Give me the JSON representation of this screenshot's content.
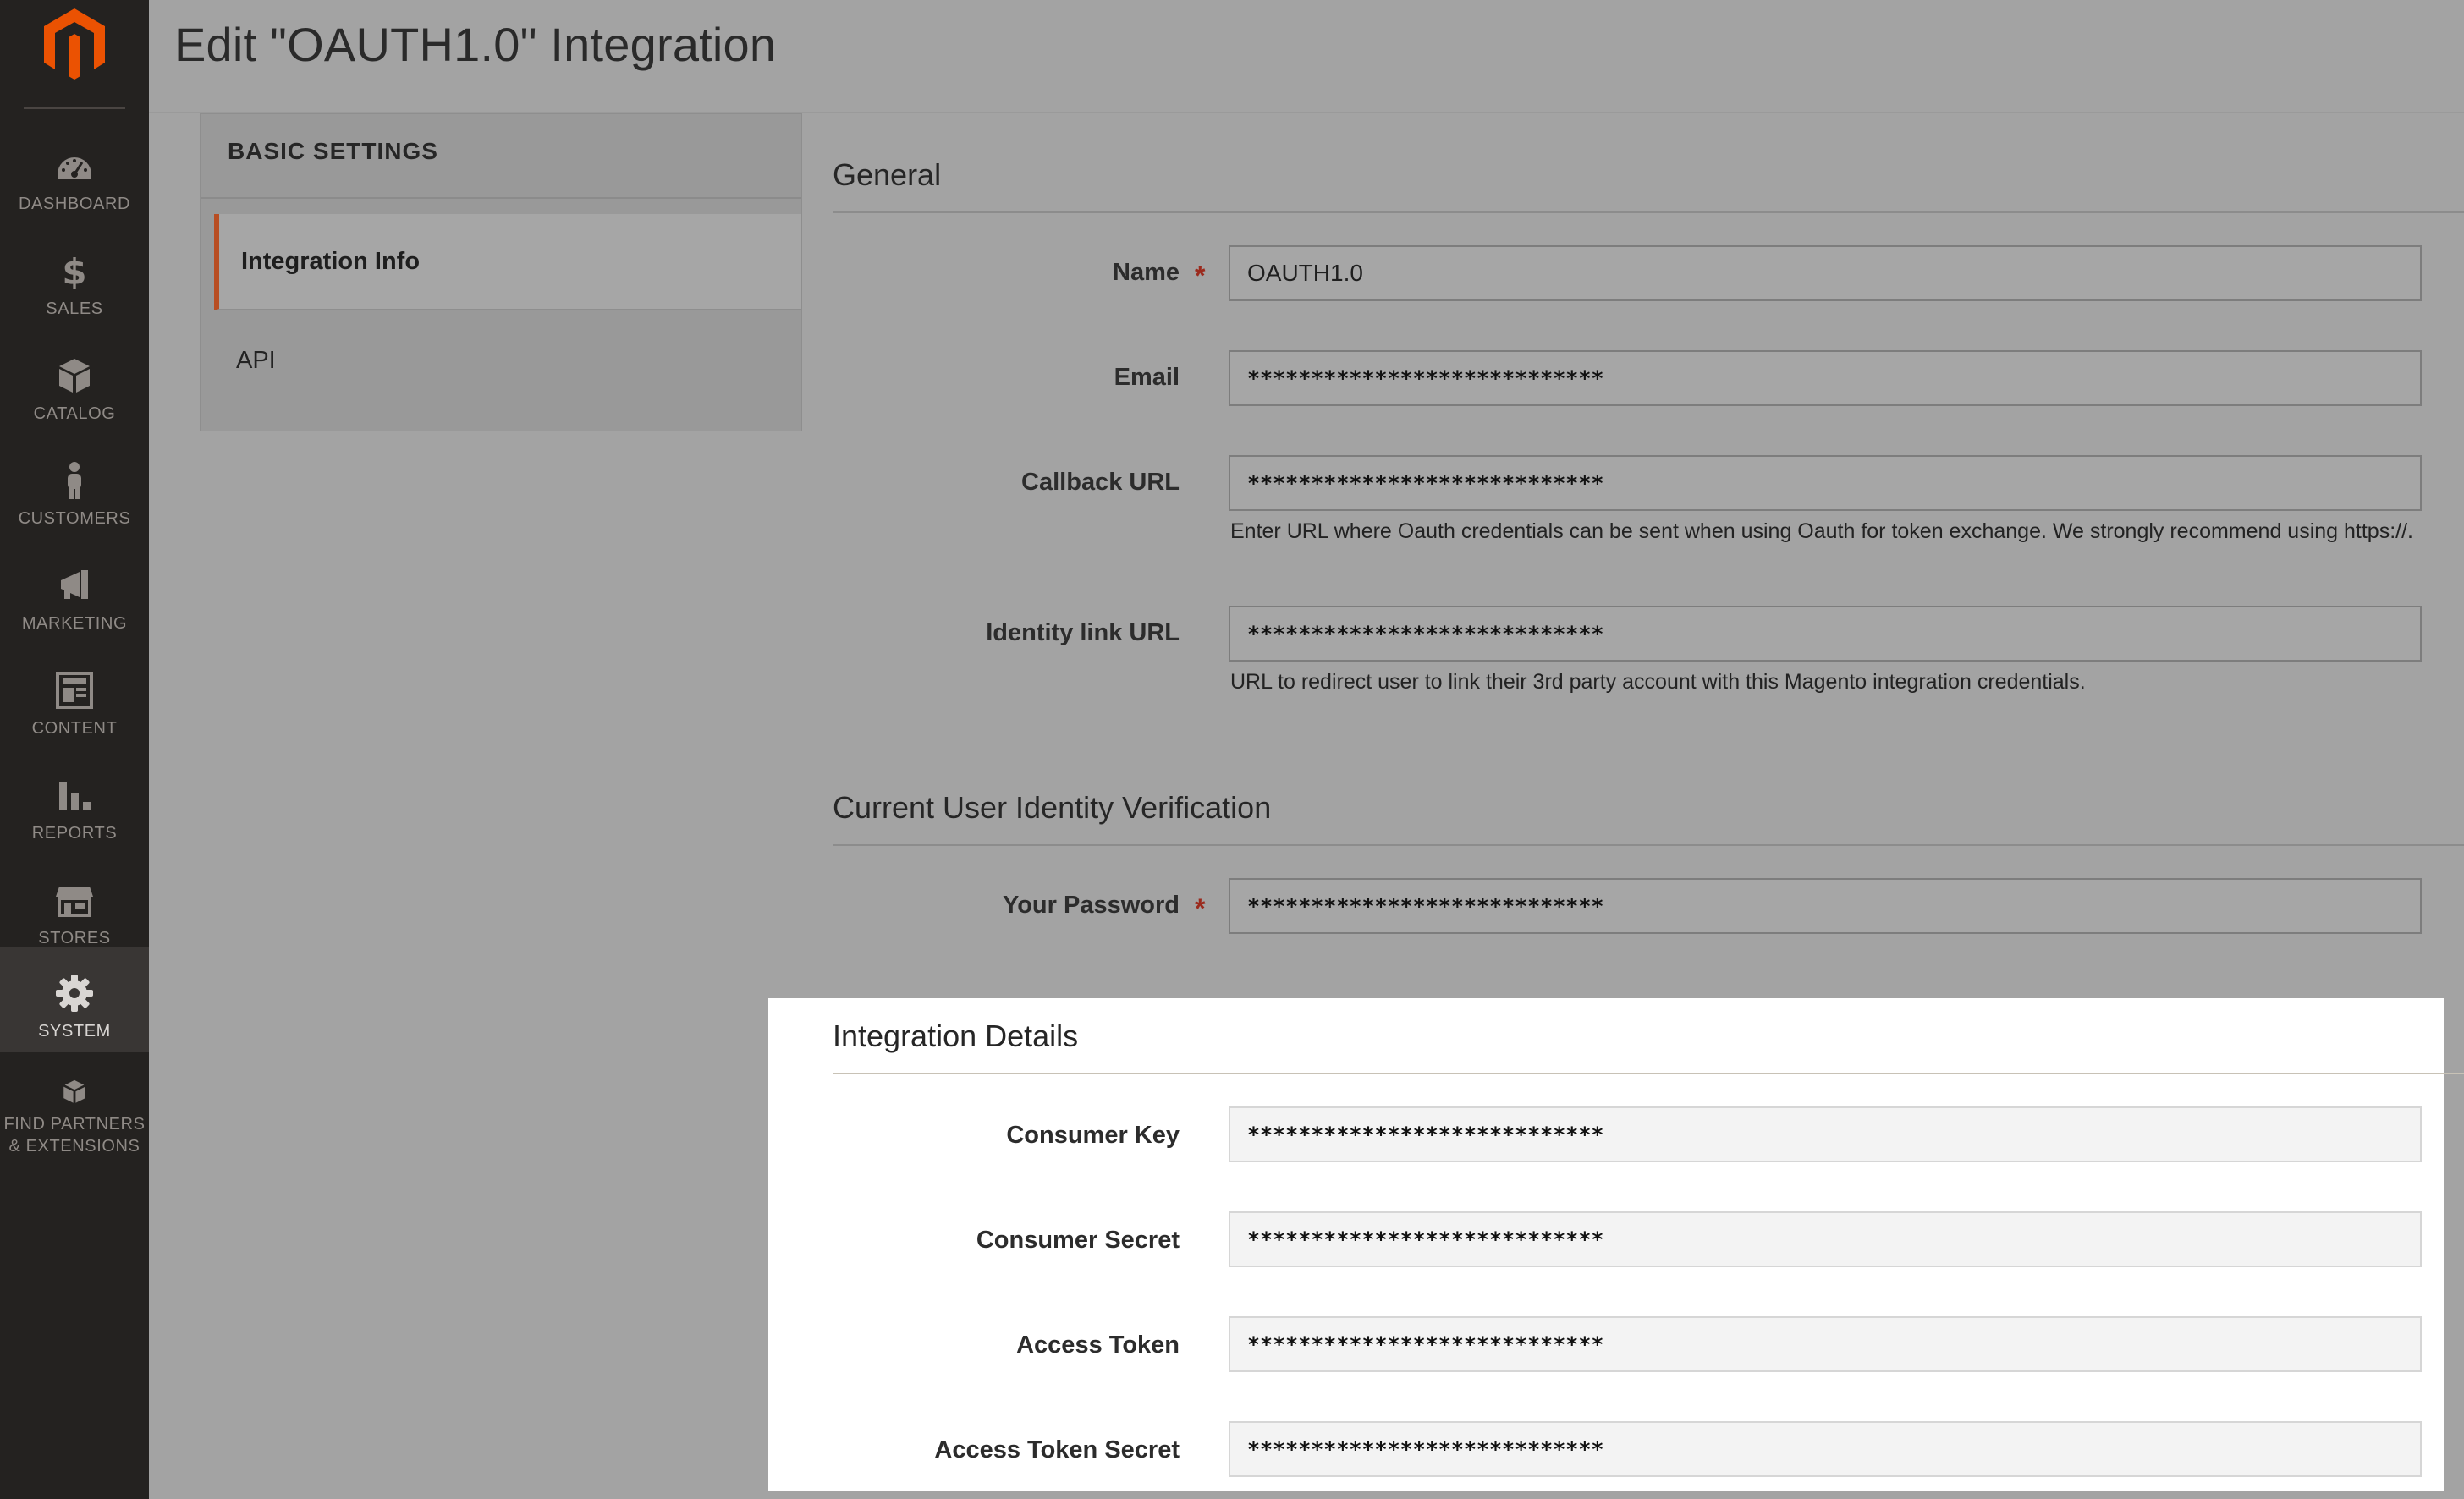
{
  "page": {
    "title": "Edit \"OAUTH1.0\" Integration"
  },
  "sidebar": {
    "items": [
      {
        "label": "DASHBOARD",
        "icon": "dashboard-icon"
      },
      {
        "label": "SALES",
        "icon": "dollar-icon"
      },
      {
        "label": "CATALOG",
        "icon": "box-icon"
      },
      {
        "label": "CUSTOMERS",
        "icon": "person-icon"
      },
      {
        "label": "MARKETING",
        "icon": "megaphone-icon"
      },
      {
        "label": "CONTENT",
        "icon": "layout-icon"
      },
      {
        "label": "REPORTS",
        "icon": "bar-chart-icon"
      },
      {
        "label": "STORES",
        "icon": "storefront-icon"
      },
      {
        "label": "SYSTEM",
        "icon": "gear-icon",
        "active": true
      },
      {
        "label": "FIND PARTNERS\n& EXTENSIONS",
        "icon": "cubes-icon"
      }
    ],
    "accent": "#eb5202"
  },
  "tabs": {
    "title": "BASIC SETTINGS",
    "items": [
      {
        "label": "Integration Info",
        "active": true
      },
      {
        "label": "API"
      }
    ],
    "active_color": "#b84e23"
  },
  "general": {
    "title": "General",
    "name_label": "Name",
    "name_value": "OAUTH1.0",
    "email_label": "Email",
    "email_value": "****************************",
    "callback_label": "Callback URL",
    "callback_value": "****************************",
    "callback_note": "Enter URL where Oauth credentials can be sent when using Oauth for token exchange. We strongly recommend using https://.",
    "identity_label": "Identity link URL",
    "identity_value": "****************************",
    "identity_note": "URL to redirect user to link their 3rd party account with this Magento integration credentials."
  },
  "verification": {
    "title": "Current User Identity Verification",
    "password_label": "Your Password",
    "password_value": "****************************"
  },
  "details": {
    "title": "Integration Details",
    "consumer_key_label": "Consumer Key",
    "consumer_key_value": "****************************",
    "consumer_secret_label": "Consumer Secret",
    "consumer_secret_value": "****************************",
    "access_token_label": "Access Token",
    "access_token_value": "****************************",
    "access_token_secret_label": "Access Token Secret",
    "access_token_secret_value": "****************************"
  },
  "required_marker": "*"
}
